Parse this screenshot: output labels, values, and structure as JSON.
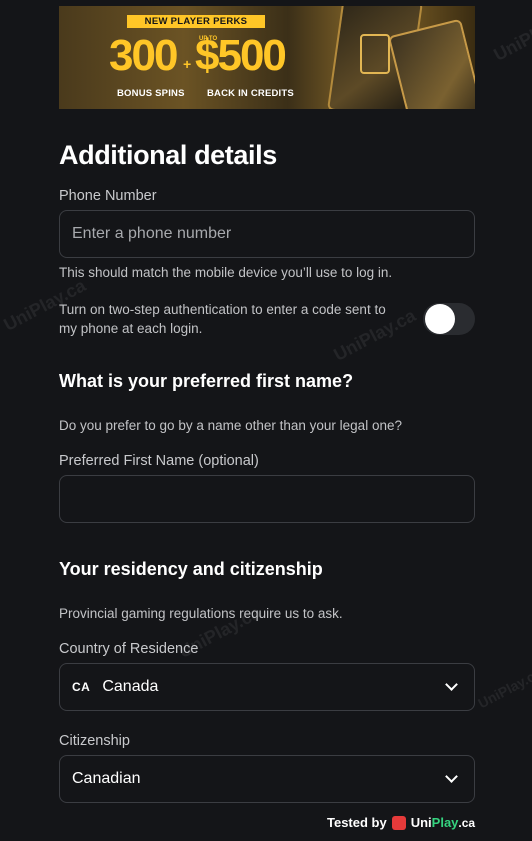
{
  "banner": {
    "tag": "NEW PLAYER PERKS",
    "spins_value": "300",
    "spins_label": "BONUS SPINS",
    "plus": "+",
    "credits_upto": "UP TO",
    "credits_value": "$500",
    "credits_label": "BACK IN CREDITS"
  },
  "page_title": "Additional details",
  "phone": {
    "label": "Phone Number",
    "placeholder": "Enter a phone number",
    "value": "",
    "help": "This should match the mobile device you’ll use to log in."
  },
  "two_step": {
    "text": "Turn on two-step authentication to enter a code sent to my phone at each login.",
    "enabled": false
  },
  "preferred_name": {
    "heading": "What is your preferred first name?",
    "question": "Do you prefer to go by a name other than your legal one?",
    "label": "Preferred First Name (optional)",
    "value": ""
  },
  "residency": {
    "heading": "Your residency and citizenship",
    "help": "Provincial gaming regulations require us to ask.",
    "country_label": "Country of Residence",
    "country_code": "CA",
    "country_value": "Canada",
    "citizenship_label": "Citizenship",
    "citizenship_value": "Canadian"
  },
  "footer": {
    "tested_by": "Tested by",
    "brand_uni": "Uni",
    "brand_play": "Play",
    "brand_tld": ".ca"
  },
  "watermark": "UniPlay.ca",
  "colors": {
    "background": "#141518",
    "accent_gold": "#ffc627",
    "brand_green": "#35d37f",
    "brand_red": "#e63a3a"
  }
}
